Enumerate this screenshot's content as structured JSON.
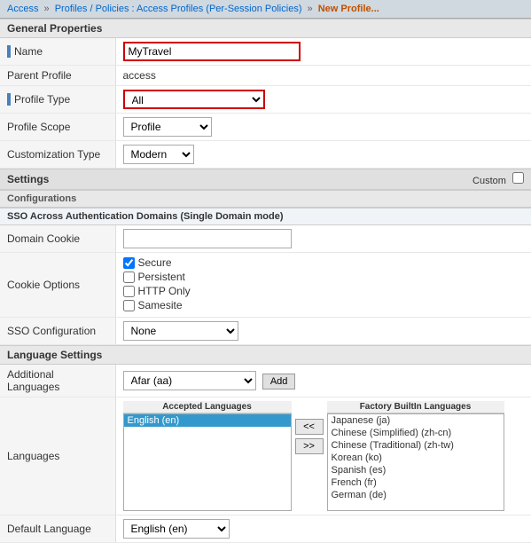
{
  "breadcrumb": {
    "items": [
      "Access",
      "Profiles / Policies : Access Profiles (Per-Session Policies)"
    ],
    "current": "New Profile..."
  },
  "generalProperties": {
    "header": "General Properties",
    "fields": {
      "name": {
        "label": "Name",
        "value": "MyTravel"
      },
      "parentProfile": {
        "label": "Parent Profile",
        "value": "access"
      },
      "profileType": {
        "label": "Profile Type",
        "value": "All"
      },
      "profileScope": {
        "label": "Profile Scope",
        "value": "Profile"
      },
      "customizationType": {
        "label": "Customization Type",
        "value": "Modern"
      }
    }
  },
  "settings": {
    "label": "Settings",
    "customLabel": "Custom"
  },
  "configurations": {
    "header": "Configurations",
    "ssoHeader": "SSO Across Authentication Domains (Single Domain mode)",
    "fields": {
      "domainCookie": {
        "label": "Domain Cookie",
        "value": ""
      },
      "cookieOptions": {
        "label": "Cookie Options",
        "options": [
          {
            "name": "Secure",
            "checked": true
          },
          {
            "name": "Persistent",
            "checked": false
          },
          {
            "name": "HTTP Only",
            "checked": false
          },
          {
            "name": "Samesite",
            "checked": false
          }
        ]
      },
      "ssoConfiguration": {
        "label": "SSO Configuration",
        "value": "None"
      }
    }
  },
  "languageSettings": {
    "header": "Language Settings",
    "additionalLanguages": {
      "label": "Additional Languages",
      "selectedValue": "Afar (aa)",
      "addButton": "Add"
    },
    "languages": {
      "label": "Languages",
      "acceptedHeader": "Accepted Languages",
      "factoryHeader": "Factory BuiltIn Languages",
      "acceptedList": [
        "English (en)"
      ],
      "factoryList": [
        "Japanese (ja)",
        "Chinese (Simplified) (zh-cn)",
        "Chinese (Traditional) (zh-tw)",
        "Korean (ko)",
        "Spanish (es)",
        "French (fr)",
        "German (de)"
      ],
      "leftArrow": "<<",
      "rightArrow": ">>"
    },
    "defaultLanguage": {
      "label": "Default Language",
      "value": "English (en)"
    }
  }
}
